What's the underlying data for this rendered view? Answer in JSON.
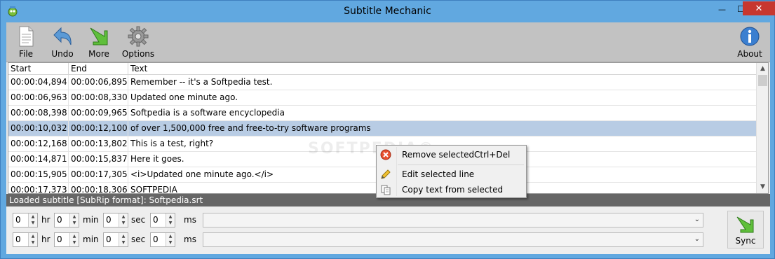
{
  "window": {
    "title": "Subtitle Mechanic",
    "min_glyph": "—",
    "max_glyph": "☐",
    "close_glyph": "✕",
    "accent": "#61a8e0",
    "close_color": "#c7372f"
  },
  "toolbar": {
    "file_label": "File",
    "undo_label": "Undo",
    "more_label": "More",
    "options_label": "Options",
    "about_label": "About"
  },
  "grid": {
    "columns": [
      "Start",
      "End",
      "Text"
    ],
    "rows": [
      {
        "start": "00:00:04,894",
        "end": "00:00:06,895",
        "text": "Remember -- it's a Softpedia test."
      },
      {
        "start": "00:00:06,963",
        "end": "00:00:08,330",
        "text": "Updated one minute ago."
      },
      {
        "start": "00:00:08,398",
        "end": "00:00:09,965",
        "text": "Softpedia is a software encyclopedia"
      },
      {
        "start": "00:00:10,032",
        "end": "00:00:12,100",
        "text": "of over 1,500,000 free  and free-to-try software programs"
      },
      {
        "start": "00:00:12,168",
        "end": "00:00:13,802",
        "text": "This is a test, right?"
      },
      {
        "start": "00:00:14,871",
        "end": "00:00:15,837",
        "text": "Here it goes."
      },
      {
        "start": "00:00:15,905",
        "end": "00:00:17,305",
        "text": "<i>Updated one minute ago.</i>"
      },
      {
        "start": "00:00:17,373",
        "end": "00:00:18,306",
        "text": "SOFTPEDIA"
      }
    ],
    "selected_row": 3,
    "scroll_up": "▲",
    "scroll_down": "▼"
  },
  "context_menu": {
    "remove_label": "Remove selected",
    "remove_shortcut": "Ctrl+Del",
    "edit_label": "Edit selected line",
    "copy_label": "Copy text from selected"
  },
  "status": {
    "text": "Loaded subtitle [SubRip format]: Softpedia.srt"
  },
  "time_rows": [
    {
      "hr": "0",
      "min": "0",
      "sec": "0",
      "ms": "0",
      "combo_value": ""
    },
    {
      "hr": "0",
      "min": "0",
      "sec": "0",
      "ms": "0",
      "combo_value": ""
    }
  ],
  "units": {
    "hr": "hr",
    "min": "min",
    "sec": "sec",
    "ms": "ms"
  },
  "sync": {
    "label": "Sync"
  },
  "watermark": "SOFTPEDIA®",
  "spin_up": "▲",
  "spin_down": "▼",
  "combo_arrow": "⌄"
}
